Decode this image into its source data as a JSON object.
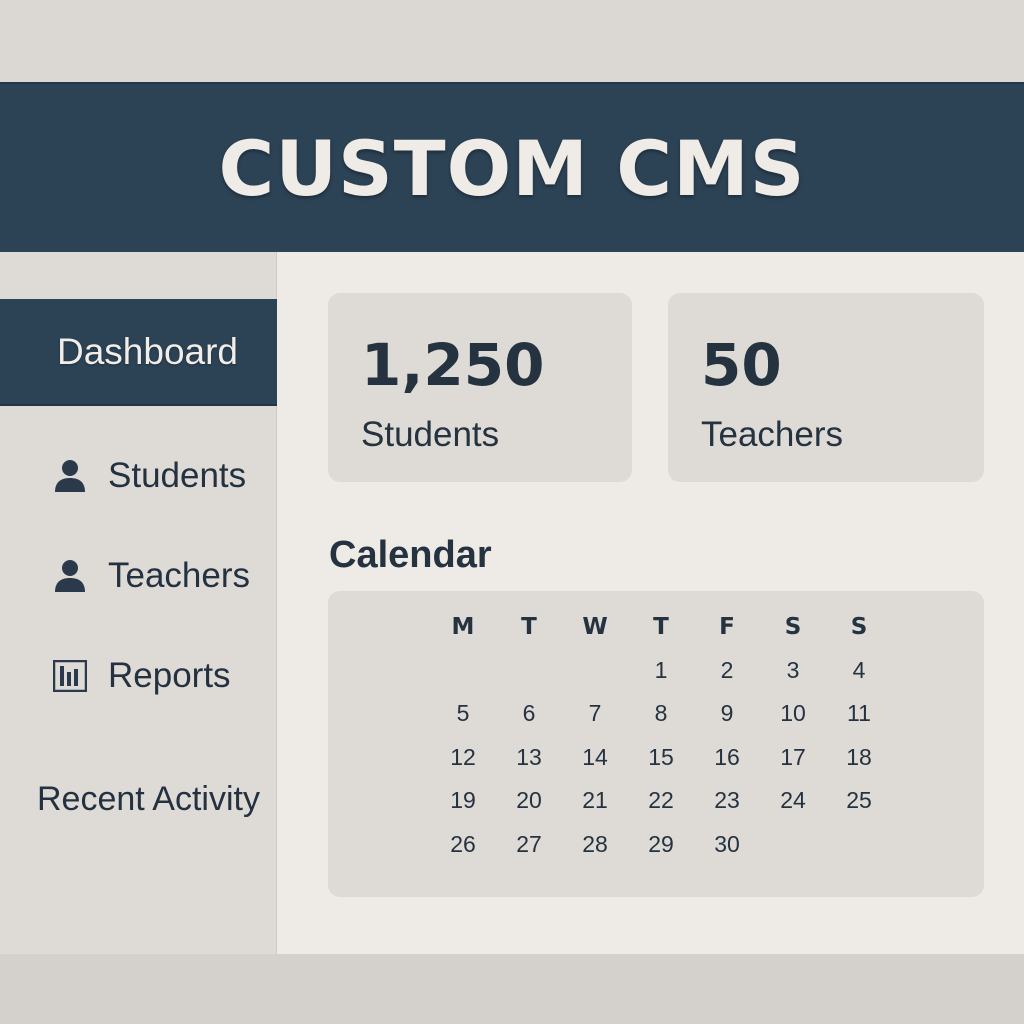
{
  "app": {
    "title": "CUSTOM CMS"
  },
  "sidebar": {
    "active": {
      "label": "Dashboard"
    },
    "items": [
      {
        "label": "Students",
        "icon": "person-icon"
      },
      {
        "label": "Teachers",
        "icon": "person-icon"
      },
      {
        "label": "Reports",
        "icon": "bar-chart-icon"
      }
    ],
    "recent_activity": "Recent Activity"
  },
  "stats": [
    {
      "value": "1,250",
      "caption": "Students"
    },
    {
      "value": "50",
      "caption": "Teachers"
    }
  ],
  "calendar": {
    "title": "Calendar",
    "weekdays": [
      "M",
      "T",
      "W",
      "T",
      "F",
      "S",
      "S"
    ],
    "leading_blanks": 3,
    "days": [
      "1",
      "2",
      "3",
      "4",
      "5",
      "6",
      "7",
      "8",
      "9",
      "10",
      "11",
      "12",
      "13",
      "14",
      "15",
      "16",
      "17",
      "18",
      "19",
      "20",
      "21",
      "22",
      "23",
      "24",
      "25",
      "26",
      "27",
      "28",
      "29",
      "30"
    ]
  },
  "colors": {
    "header_bg": "#2c4255",
    "page_bg": "#eeebe7",
    "card_bg": "#dedbd7",
    "text": "#25323f"
  }
}
